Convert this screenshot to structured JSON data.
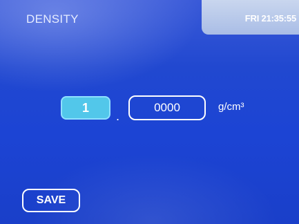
{
  "header": {
    "title": "DENSITY",
    "clock": "FRI 21:35:55"
  },
  "density": {
    "integer_value": "1",
    "decimal_point": ".",
    "fraction_value": "0000",
    "unit": "g/cm³"
  },
  "footer": {
    "save_label": "SAVE"
  },
  "colors": {
    "background": "#1c44d4",
    "selected_field": "#52c7ea",
    "clock_panel": "#b8c9ea"
  }
}
